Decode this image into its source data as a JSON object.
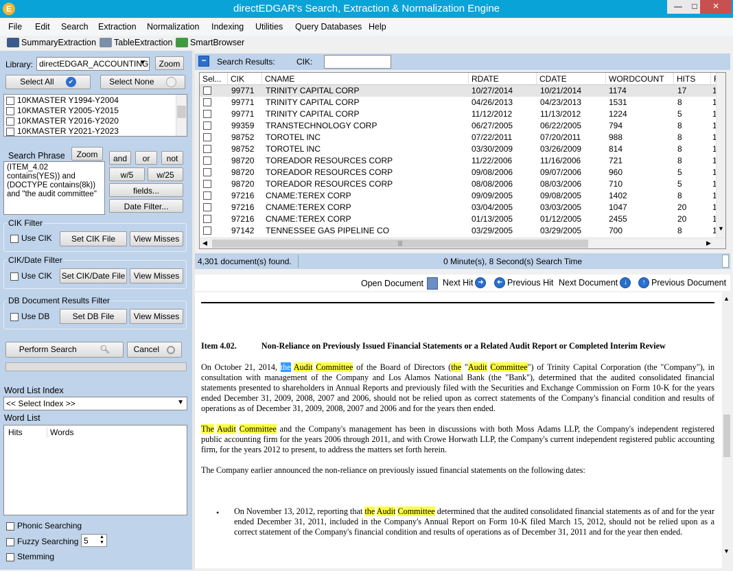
{
  "window": {
    "title": "directEDGAR's Search, Extraction & Normalization Engine",
    "app_icon_letter": "E",
    "min_label": "—",
    "max_label": "□",
    "close_label": "✕"
  },
  "menu": [
    "File",
    "Edit",
    "Search",
    "Extraction",
    "Normalization",
    "Indexing",
    "Utilities",
    "Query Databases",
    "Help"
  ],
  "toolbar": [
    "SummaryExtraction",
    "TableExtraction",
    "SmartBrowser"
  ],
  "left": {
    "library_label": "Library:",
    "library_value": "directEDGAR_ACCOUNTING",
    "zoom_label": "Zoom",
    "select_all": "Select All",
    "select_none": "Select None",
    "libraries": [
      "10KMASTER Y1994-Y2004",
      "10KMASTER Y2005-Y2015",
      "10KMASTER Y2016-Y2020",
      "10KMASTER Y2021-Y2023"
    ],
    "search_phrase_label": "Search Phrase",
    "search_zoom": "Zoom",
    "search_text": "(ITEM_4.02 contains(YES)) and (DOCTYPE contains(8k)) and \"the audit committee\"",
    "op_and": "and",
    "op_or": "or",
    "op_not": "not",
    "op_w5": "w/5",
    "op_w25": "w/25",
    "fields": "fields...",
    "date_filter": "Date Filter...",
    "cik_filter": {
      "title": "CIK Filter",
      "use": "Use CIK",
      "set": "Set CIK File",
      "misses": "View Misses"
    },
    "cikdate_filter": {
      "title": "CIK/Date Filter",
      "use": "Use CIK",
      "set": "Set CIK/Date File",
      "misses": "View Misses"
    },
    "db_filter": {
      "title": "DB Document Results Filter",
      "use": "Use DB",
      "set": "Set DB File",
      "misses": "View Misses"
    },
    "perform_search": "Perform Search",
    "cancel": "Cancel",
    "word_list_index_label": "Word List Index",
    "select_index": "<< Select Index >>",
    "word_list_label": "Word List",
    "wl_hits": "Hits",
    "wl_words": "Words",
    "phonic": "Phonic Searching",
    "fuzzy": "Fuzzy Searching",
    "fuzzy_value": "5",
    "stemming": "Stemming"
  },
  "results": {
    "label": "Search Results:",
    "cik_label": "CIK:",
    "cik_value": "",
    "columns": [
      "Sel...",
      "CIK",
      "CNAME",
      "RDATE",
      "CDATE",
      "WORDCOUNT",
      "HITS",
      "F"
    ],
    "rows": [
      [
        "99771",
        "TRINITY CAPITAL CORP",
        "10/27/2014",
        "10/21/2014",
        "1174",
        "17",
        "1"
      ],
      [
        "99771",
        "TRINITY CAPITAL CORP",
        "04/26/2013",
        "04/23/2013",
        "1531",
        "8",
        "1"
      ],
      [
        "99771",
        "TRINITY CAPITAL CORP",
        "11/12/2012",
        "11/13/2012",
        "1224",
        "5",
        "1"
      ],
      [
        "99359",
        "TRANSTECHNOLOGY CORP",
        "06/27/2005",
        "06/22/2005",
        "794",
        "8",
        "1"
      ],
      [
        "98752",
        "TOROTEL INC",
        "07/22/2011",
        "07/20/2011",
        "988",
        "8",
        "1"
      ],
      [
        "98752",
        "TOROTEL INC",
        "03/30/2009",
        "03/26/2009",
        "814",
        "8",
        "1"
      ],
      [
        "98720",
        "TOREADOR RESOURCES CORP",
        "11/22/2006",
        "11/16/2006",
        "721",
        "8",
        "1"
      ],
      [
        "98720",
        "TOREADOR RESOURCES CORP",
        "09/08/2006",
        "09/07/2006",
        "960",
        "5",
        "1"
      ],
      [
        "98720",
        "TOREADOR RESOURCES CORP",
        "08/08/2006",
        "08/03/2006",
        "710",
        "5",
        "1"
      ],
      [
        "97216",
        "CNAME:TEREX CORP",
        "09/09/2005",
        "09/08/2005",
        "1402",
        "8",
        "1"
      ],
      [
        "97216",
        "CNAME:TEREX CORP",
        "03/04/2005",
        "03/03/2005",
        "1047",
        "20",
        "1"
      ],
      [
        "97216",
        "CNAME:TEREX CORP",
        "01/13/2005",
        "01/12/2005",
        "2455",
        "20",
        "1"
      ],
      [
        "97142",
        "TENNESSEE GAS PIPELINE CO",
        "03/29/2005",
        "03/29/2005",
        "700",
        "8",
        "1"
      ]
    ],
    "found": "4,301 document(s) found.",
    "time": "0 Minute(s), 8 Second(s) Search Time"
  },
  "viewer_nav": {
    "open": "Open Document",
    "next_hit": "Next Hit",
    "prev_hit": "Previous Hit",
    "next_doc": "Next Document",
    "prev_doc": "Previous Document"
  },
  "document": {
    "heading_item": "Item 4.02.",
    "heading_title": "Non-Reliance on Previously Issued Financial Statements or a Related Audit Report or Completed Interim Review",
    "p1_a": "On October 21, 2014, ",
    "w_the": "the",
    "w_audit": "Audit",
    "w_committee": "Committee",
    "w_The": "The",
    "p1_b": " of the Board of Directors (",
    "p1_c": " \"",
    "p1_d": "\") of Trinity Capital Corporation (the \"Company\"), in consultation with management of the Company and Los Alamos National Bank (the \"Bank\"), determined that the audited consolidated financial statements presented to shareholders in Annual Reports and previously filed with the Securities and Exchange Commission on Form 10-K for the years ended December 31, 2009, 2008, 2007 and 2006, should not be relied upon as correct statements of the Company's financial condition and results of operations as of December 31, 2009, 2008, 2007 and 2006 and for the years then ended.",
    "p2": " and the Company's management has been in discussions with both Moss Adams LLP, the Company's independent registered public accounting firm for the years 2006 through 2011, and with Crowe Horwath LLP, the Company's current independent registered public accounting firm, for the years 2012 to present, to address the matters set forth herein.",
    "p3": "The Company earlier announced the non-reliance on previously issued financial statements on the following dates:",
    "b1_a": "On November 13, 2012, reporting that ",
    "b1_b": " determined that the audited consolidated financial statements as of and for the year ended December 31, 2011, included in the Company's Annual Report on Form 10-K filed March 15, 2012, should not be relied upon as a correct statement of the Company's financial condition and results of operations as of December 31, 2011 and for the year then ended."
  }
}
